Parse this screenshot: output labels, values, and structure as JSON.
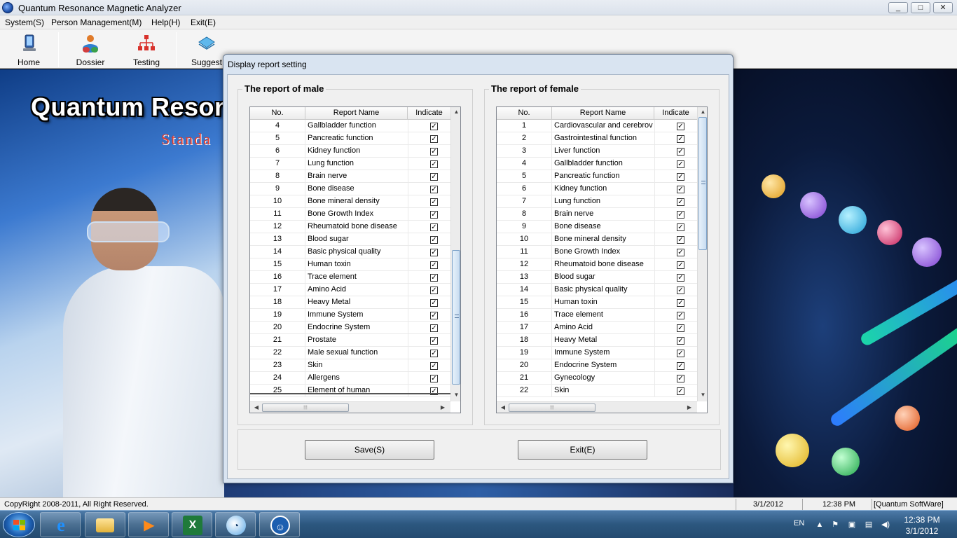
{
  "window": {
    "title": "Quantum Resonance Magnetic Analyzer",
    "min": "_",
    "max": "□",
    "close": "✕"
  },
  "menu": [
    "System(S)",
    "Person Management(M)",
    "Help(H)",
    "Exit(E)"
  ],
  "toolbar": [
    {
      "label": "Home",
      "icon": "monitor-icon"
    },
    {
      "label": "Dossier",
      "icon": "users-icon"
    },
    {
      "label": "Testing",
      "icon": "network-icon"
    },
    {
      "label": "Suggest",
      "icon": "book-icon"
    }
  ],
  "brand": {
    "title": "Quantum Resona",
    "subtitle": "Standa"
  },
  "dialog": {
    "title": "Display report setting",
    "save_label": "Save(S)",
    "exit_label": "Exit(E)",
    "male": {
      "caption": "The report of male",
      "headers": {
        "no": "No.",
        "name": "Report Name",
        "indicate": "Indicate"
      },
      "rows": [
        {
          "no": "4",
          "name": "Gallbladder function",
          "checked": true
        },
        {
          "no": "5",
          "name": "Pancreatic function",
          "checked": true
        },
        {
          "no": "6",
          "name": "Kidney function",
          "checked": true
        },
        {
          "no": "7",
          "name": "Lung function",
          "checked": true
        },
        {
          "no": "8",
          "name": "Brain nerve",
          "checked": true
        },
        {
          "no": "9",
          "name": "Bone disease",
          "checked": true
        },
        {
          "no": "10",
          "name": "Bone mineral density",
          "checked": true
        },
        {
          "no": "11",
          "name": "Bone Growth Index",
          "checked": true
        },
        {
          "no": "12",
          "name": "Rheumatoid bone disease",
          "checked": true
        },
        {
          "no": "13",
          "name": "Blood sugar",
          "checked": true
        },
        {
          "no": "14",
          "name": "Basic physical quality",
          "checked": true
        },
        {
          "no": "15",
          "name": "Human toxin",
          "checked": true
        },
        {
          "no": "16",
          "name": "Trace element",
          "checked": true
        },
        {
          "no": "17",
          "name": "Amino Acid",
          "checked": true
        },
        {
          "no": "18",
          "name": "Heavy Metal",
          "checked": true
        },
        {
          "no": "19",
          "name": "Immune System",
          "checked": true
        },
        {
          "no": "20",
          "name": "Endocrine System",
          "checked": true
        },
        {
          "no": "21",
          "name": "Prostate",
          "checked": true
        },
        {
          "no": "22",
          "name": "Male sexual function",
          "checked": true
        },
        {
          "no": "23",
          "name": "Skin",
          "checked": true
        },
        {
          "no": "24",
          "name": "Allergens",
          "checked": true
        },
        {
          "no": "25",
          "name": "Element of human",
          "checked": true
        }
      ]
    },
    "female": {
      "caption": "The report of female",
      "headers": {
        "no": "No.",
        "name": "Report Name",
        "indicate": "Indicate"
      },
      "rows": [
        {
          "no": "1",
          "name": "Cardiovascular and cerebrov",
          "checked": true
        },
        {
          "no": "2",
          "name": "Gastrointestinal function",
          "checked": true
        },
        {
          "no": "3",
          "name": "Liver function",
          "checked": true
        },
        {
          "no": "4",
          "name": "Gallbladder function",
          "checked": true
        },
        {
          "no": "5",
          "name": "Pancreatic function",
          "checked": true
        },
        {
          "no": "6",
          "name": "Kidney function",
          "checked": true
        },
        {
          "no": "7",
          "name": "Lung function",
          "checked": true
        },
        {
          "no": "8",
          "name": "Brain nerve",
          "checked": true
        },
        {
          "no": "9",
          "name": "Bone disease",
          "checked": true
        },
        {
          "no": "10",
          "name": "Bone mineral density",
          "checked": true
        },
        {
          "no": "11",
          "name": "Bone Growth Index",
          "checked": true
        },
        {
          "no": "12",
          "name": "Rheumatoid bone disease",
          "checked": true
        },
        {
          "no": "13",
          "name": "Blood sugar",
          "checked": true
        },
        {
          "no": "14",
          "name": "Basic physical quality",
          "checked": true
        },
        {
          "no": "15",
          "name": "Human toxin",
          "checked": true
        },
        {
          "no": "16",
          "name": "Trace element",
          "checked": true
        },
        {
          "no": "17",
          "name": "Amino Acid",
          "checked": true
        },
        {
          "no": "18",
          "name": "Heavy Metal",
          "checked": true
        },
        {
          "no": "19",
          "name": "Immune System",
          "checked": true
        },
        {
          "no": "20",
          "name": "Endocrine System",
          "checked": true
        },
        {
          "no": "21",
          "name": "Gynecology",
          "checked": true
        },
        {
          "no": "22",
          "name": "Skin",
          "checked": true
        }
      ]
    }
  },
  "statusbar": {
    "copyright": "CopyRight 2008-2011, All Right Reserved.",
    "date": "3/1/2012",
    "time": "12:38 PM",
    "app": "[Quantum SoftWare]"
  },
  "taskbar": {
    "apps": [
      "ie-icon",
      "folder-icon",
      "media-player-icon",
      "excel-icon",
      "qq-icon",
      "accessibility-icon"
    ],
    "language": "EN",
    "clock_time": "12:38 PM",
    "clock_date": "3/1/2012"
  }
}
